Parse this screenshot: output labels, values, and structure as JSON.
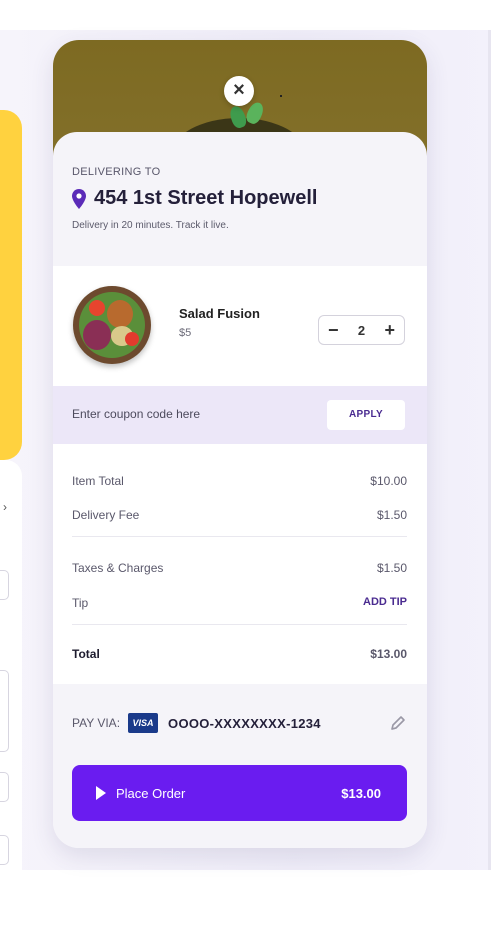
{
  "header": {
    "close_icon": "close-icon",
    "close_glyph": "×"
  },
  "delivery": {
    "eyebrow": "DELIVERING TO",
    "address": "454 1st Street  Hopewell",
    "subtext": "Delivery in 20 minutes. Track it live.",
    "pin_icon": "location-pin-icon",
    "pin_color": "#5b2bb8"
  },
  "item": {
    "name": "Salad Fusion",
    "price": "$5",
    "quantity": "2",
    "minus": "−",
    "plus": "+"
  },
  "coupon": {
    "placeholder": "Enter coupon code here",
    "apply_label": "APPLY"
  },
  "bill": {
    "item_total_label": "Item Total",
    "item_total_value": "$10.00",
    "delivery_fee_label": "Delivery Fee",
    "delivery_fee_value": "$1.50",
    "taxes_label": "Taxes & Charges",
    "taxes_value": "$1.50",
    "tip_label": "Tip",
    "tip_action": "ADD TIP",
    "total_label": "Total",
    "total_value": "$13.00"
  },
  "payment": {
    "label": "PAY VIA:",
    "card_brand": "VISA",
    "card_number": "OOOO-XXXXXXXX-1234",
    "edit_icon": "pencil-icon"
  },
  "order": {
    "button_label": "Place Order",
    "amount": "$13.00",
    "accent_color": "#6a1cf0"
  }
}
